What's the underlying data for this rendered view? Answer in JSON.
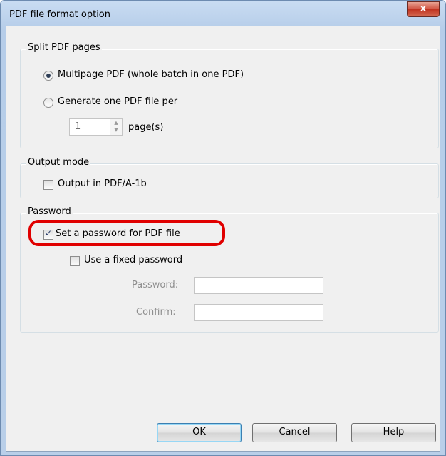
{
  "window": {
    "title": "PDF file format option",
    "close_label": "x"
  },
  "split": {
    "label": "Split PDF pages",
    "option_multipage": "Multipage PDF (whole batch in one PDF)",
    "option_per_page": "Generate one PDF file per",
    "selected": "multipage",
    "pages_value": "1",
    "pages_unit": "page(s)"
  },
  "output": {
    "label": "Output mode",
    "pdfa_label": "Output in PDF/A-1b",
    "pdfa_checked": false
  },
  "password": {
    "label": "Password",
    "set_label": "Set a password for PDF file",
    "set_checked": true,
    "fixed_label": "Use a fixed password",
    "fixed_checked": false,
    "password_field_label": "Password:",
    "confirm_field_label": "Confirm:"
  },
  "buttons": {
    "ok": "OK",
    "cancel": "Cancel",
    "help": "Help"
  },
  "colors": {
    "highlight": "#e00000",
    "title_gradient": "#c9dcf2"
  }
}
